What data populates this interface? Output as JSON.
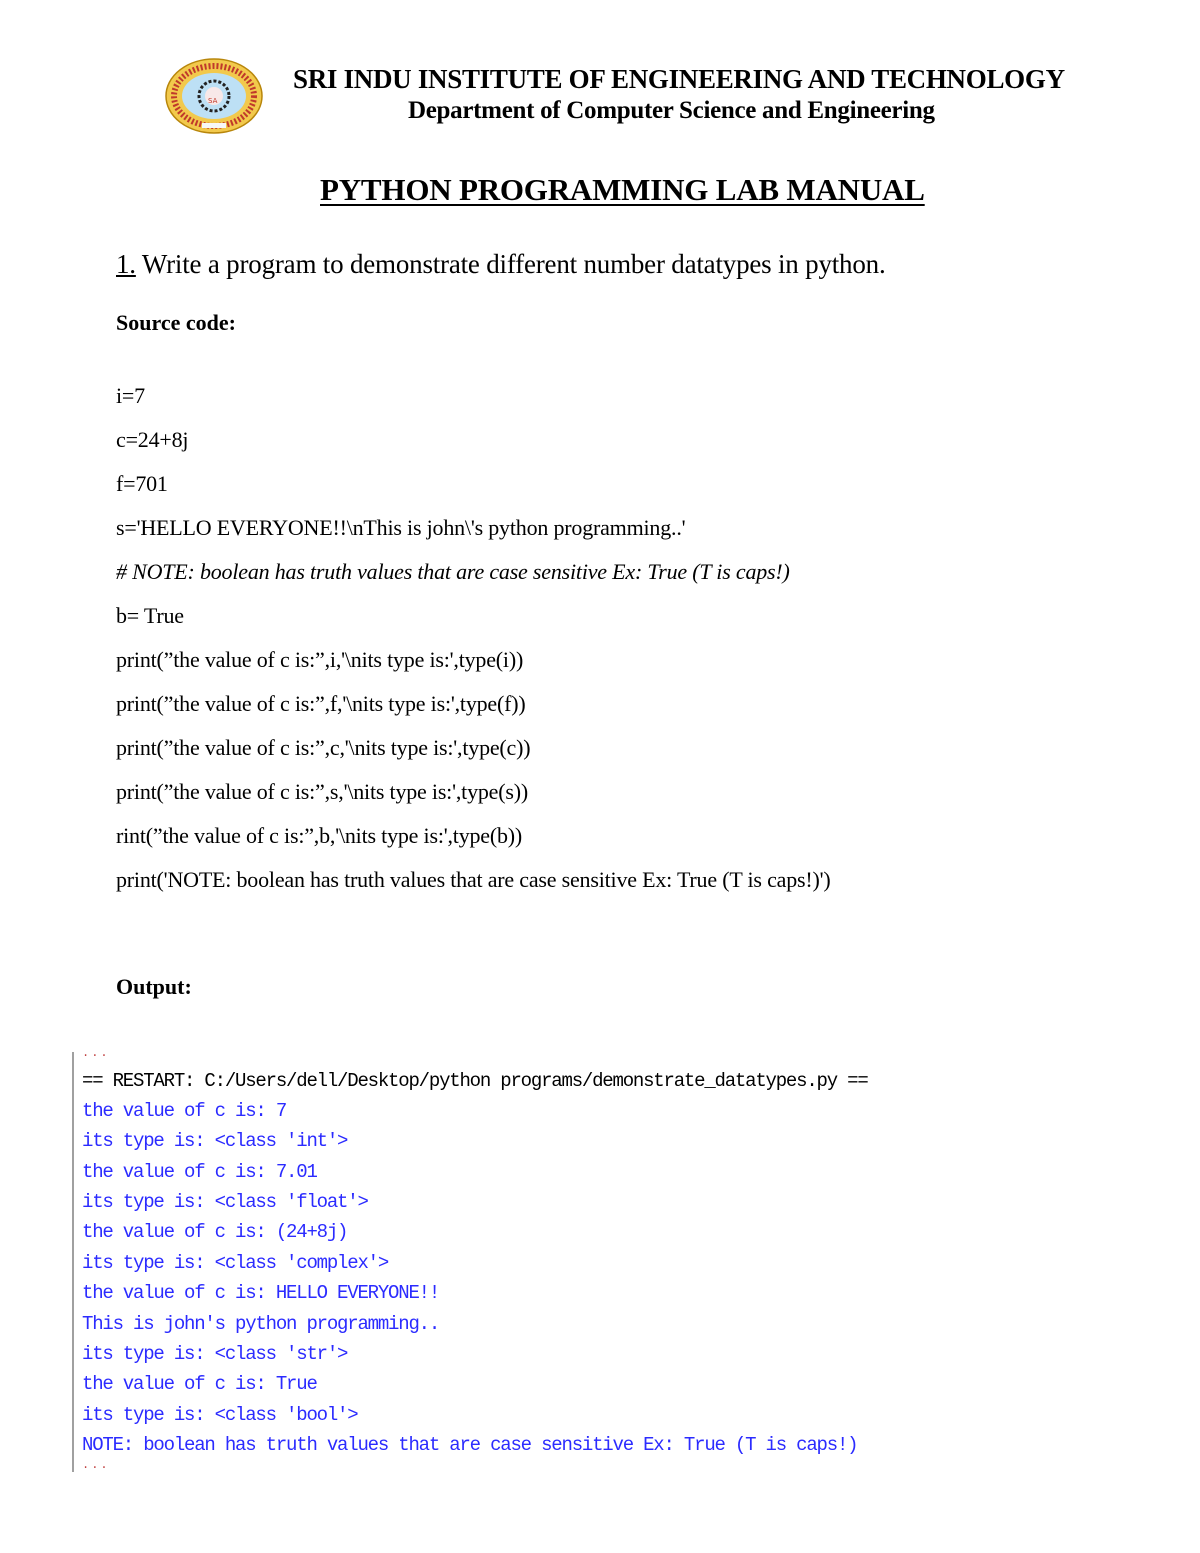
{
  "header": {
    "logo_icon": "institute-emblem-icon",
    "institute_name": "SRI INDU  INSTITUTE OF ENGINEERING AND TECHNOLOGY",
    "department": "Department of Computer Science and Engineering"
  },
  "title": "PYTHON PROGRAMMING LAB MANUAL",
  "question": {
    "number": "1.",
    "text": " Write a program to demonstrate different number datatypes in python."
  },
  "source_code": {
    "label": "Source code:",
    "lines": [
      "i=7",
      "c=24+8j",
      "f=701",
      "s='HELLO EVERYONE!!\\nThis is john\\'s python programming..'",
      "# NOTE: boolean has truth values that are case sensitive Ex: True (T is caps!)",
      "b= True",
      "print(”the value of c is:”,i,'\\nits type is:',type(i))",
      "print(”the value of c is:”,f,'\\nits type is:',type(f))",
      "print(”the value of c is:”,c,'\\nits type is:',type(c))",
      "print(”the value of c is:”,s,'\\nits type is:',type(s))",
      "rint(”the value of c is:”,b,'\\nits type is:',type(b))",
      "print('NOTE: boolean has truth values that are case sensitive Ex: True (T is caps!)')"
    ]
  },
  "output": {
    "label": "Output:",
    "prompt_dots_top": "...",
    "restart_line": "== RESTART: C:/Users/dell/Desktop/python programs/demonstrate_datatypes.py ==",
    "lines": [
      "the value of c is: 7",
      "its type is: <class 'int'>",
      "the value of c is: 7.01",
      "its type is: <class 'float'>",
      "the value of c is: (24+8j)",
      "its type is: <class 'complex'>",
      "the value of c is: HELLO EVERYONE!!",
      "This is john's python programming..",
      "its type is: <class 'str'>",
      "the value of c is: True",
      "its type is: <class 'bool'>",
      "NOTE: boolean has truth values that are case sensitive Ex: True (T is caps!)"
    ],
    "prompt_dots_bottom": "...",
    "colors": {
      "output_text": "#2b2bff",
      "system_text": "#000000",
      "prompt_dots": "#c04040"
    }
  }
}
